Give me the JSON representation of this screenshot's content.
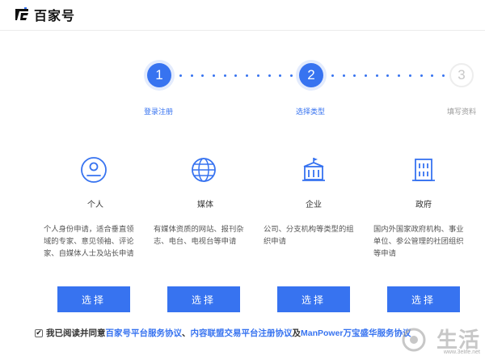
{
  "header": {
    "logo_text": "百家号"
  },
  "steps": [
    {
      "number": "1",
      "label": "登录注册",
      "state": "done"
    },
    {
      "number": "2",
      "label": "选择类型",
      "state": "current"
    },
    {
      "number": "3",
      "label": "填写资料",
      "state": "pending"
    }
  ],
  "cards": [
    {
      "icon": "user-circle-icon",
      "title": "个人",
      "desc": "个人身份申请，适合垂直领域的专家、意见领袖、评论家、自媒体人士及站长申请",
      "button": "选择"
    },
    {
      "icon": "globe-icon",
      "title": "媒体",
      "desc": "有媒体资质的网站、报刊杂志、电台、电视台等申请",
      "button": "选择"
    },
    {
      "icon": "enterprise-building-icon",
      "title": "企业",
      "desc": "公司、分支机构等类型的组织申请",
      "button": "选择"
    },
    {
      "icon": "government-building-icon",
      "title": "政府",
      "desc": "国内外国家政府机构、事业单位、参公管理的社团组织等申请",
      "button": "选择"
    }
  ],
  "agreement": {
    "checked": true,
    "prefix": "我已阅读并同意",
    "link1": "百家号平台服务协议",
    "sep1": "、",
    "link2": "内容联盟交易平台注册协议",
    "sep2": "及",
    "link3": "ManPower万宝盛华服务协议"
  },
  "watermark": {
    "text": "生活",
    "url": "www.3elife.net"
  },
  "colors": {
    "accent": "#3773f0",
    "accent_halo": "#e3ebfd"
  }
}
